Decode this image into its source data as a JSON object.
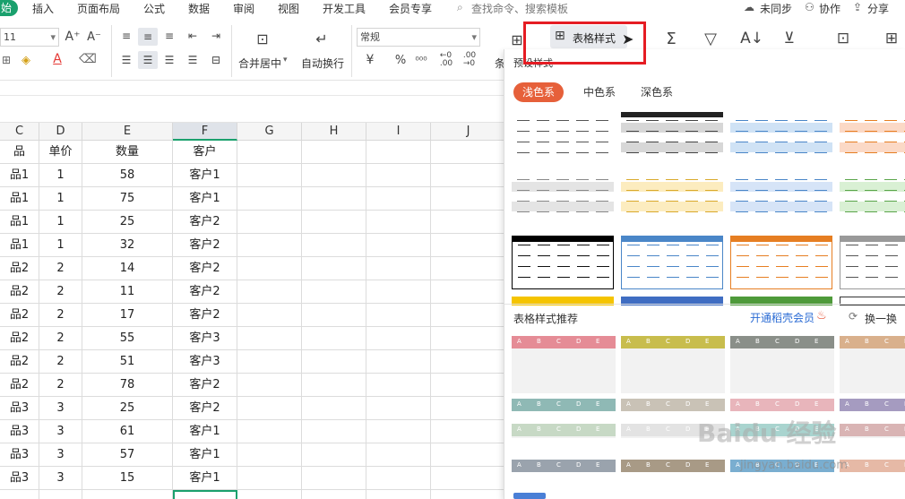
{
  "menu": {
    "start": "始",
    "items": [
      "插入",
      "页面布局",
      "公式",
      "数据",
      "审阅",
      "视图",
      "开发工具",
      "会员专享"
    ],
    "search_placeholder": "查找命令、搜索模板",
    "sync": "未同步",
    "collab": "协作",
    "share": "分享"
  },
  "ribbon": {
    "font_size": "11",
    "merge_label": "合并居中",
    "wrap_label": "自动换行",
    "number_format": "常规",
    "table_style_button": "表格样式",
    "cond_label": "条"
  },
  "grid": {
    "columns": [
      "C",
      "D",
      "E",
      "F",
      "G",
      "H",
      "I",
      "J"
    ],
    "header_row": [
      "品",
      "单价",
      "数量",
      "客户"
    ],
    "rows": [
      [
        "品1",
        "1",
        "58",
        "客户1"
      ],
      [
        "品1",
        "1",
        "75",
        "客户1"
      ],
      [
        "品1",
        "1",
        "25",
        "客户2"
      ],
      [
        "品1",
        "1",
        "32",
        "客户2"
      ],
      [
        "品2",
        "2",
        "14",
        "客户2"
      ],
      [
        "品2",
        "2",
        "11",
        "客户2"
      ],
      [
        "品2",
        "2",
        "17",
        "客户2"
      ],
      [
        "品2",
        "2",
        "55",
        "客户3"
      ],
      [
        "品2",
        "2",
        "51",
        "客户3"
      ],
      [
        "品2",
        "2",
        "78",
        "客户2"
      ],
      [
        "品3",
        "3",
        "25",
        "客户2"
      ],
      [
        "品3",
        "3",
        "61",
        "客户1"
      ],
      [
        "品3",
        "3",
        "57",
        "客户1"
      ],
      [
        "品3",
        "3",
        "15",
        "客户1"
      ]
    ]
  },
  "panel": {
    "preset_title": "预设样式",
    "tabs": [
      "浅色系",
      "中色系",
      "深色系"
    ],
    "reco_title": "表格样式推荐",
    "vip_link": "开通稻壳会员",
    "refresh": "换一换",
    "reco_header_letters": [
      "A",
      "B",
      "C",
      "D",
      "E"
    ]
  },
  "watermark": {
    "brand": "Baidu 经验",
    "url": "jingyan.baidu.com"
  },
  "colors": {
    "accent_green": "#1aa06d",
    "accent_orange": "#e6603a",
    "highlight_red": "#e51c23",
    "blue": "#4a86c8",
    "orange": "#e67e22"
  }
}
